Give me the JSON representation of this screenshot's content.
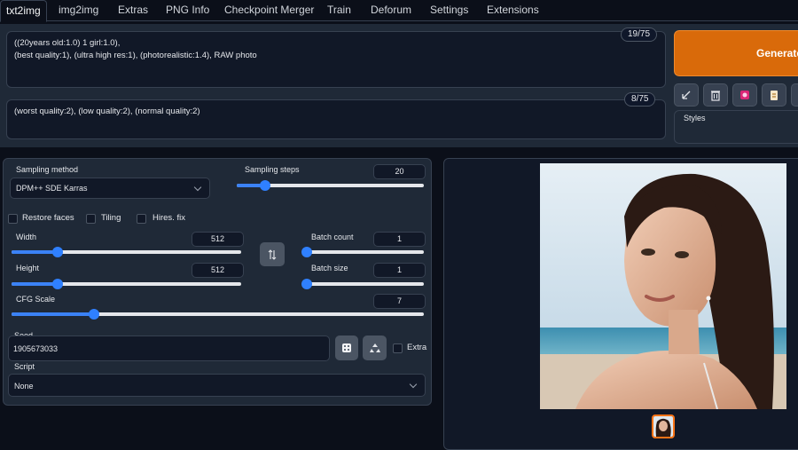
{
  "tabs": [
    "txt2img",
    "img2img",
    "Extras",
    "PNG Info",
    "Checkpoint Merger",
    "Train",
    "Deforum",
    "Settings",
    "Extensions"
  ],
  "prompt": {
    "positive_text": "((20years old:1.0) 1 girl:1.0),\n(best quality:1), (ultra high res:1), (photorealistic:1.4), RAW photo",
    "positive_tokens": "19/75",
    "negative_text": "(worst quality:2), (low quality:2), (normal quality:2)",
    "negative_tokens": "8/75"
  },
  "generate": {
    "label": "Generate"
  },
  "tools": [
    "arrow-icon",
    "trash-icon",
    "art-icon",
    "clipboard-icon",
    "save-icon"
  ],
  "styles": {
    "label": "Styles"
  },
  "settings": {
    "sampling_method_label": "Sampling method",
    "sampling_method_value": "DPM++ SDE Karras",
    "sampling_steps_label": "Sampling steps",
    "sampling_steps_value": "20",
    "restore_faces_label": "Restore faces",
    "tiling_label": "Tiling",
    "hires_fix_label": "Hires. fix",
    "width_label": "Width",
    "width_value": "512",
    "height_label": "Height",
    "height_value": "512",
    "batch_count_label": "Batch count",
    "batch_count_value": "1",
    "batch_size_label": "Batch size",
    "batch_size_value": "1",
    "cfg_scale_label": "CFG Scale",
    "cfg_scale_value": "7",
    "seed_label": "Seed",
    "seed_value": "1905673033",
    "extra_label": "Extra",
    "script_label": "Script",
    "script_value": "None",
    "swap_icon": "swap-icon",
    "dice_icon": "dice-icon",
    "recycle_icon": "recycle-icon"
  },
  "slider_levels": {
    "sampling_steps": 0.15,
    "width": 0.2,
    "height": 0.2,
    "batch_count": 0.0,
    "batch_size": 0.0,
    "cfg_scale": 0.2
  },
  "colors": {
    "accent": "#d96a0a",
    "slider": "#2f80ff",
    "panel": "#1f2937",
    "background": "#0b0f19"
  }
}
